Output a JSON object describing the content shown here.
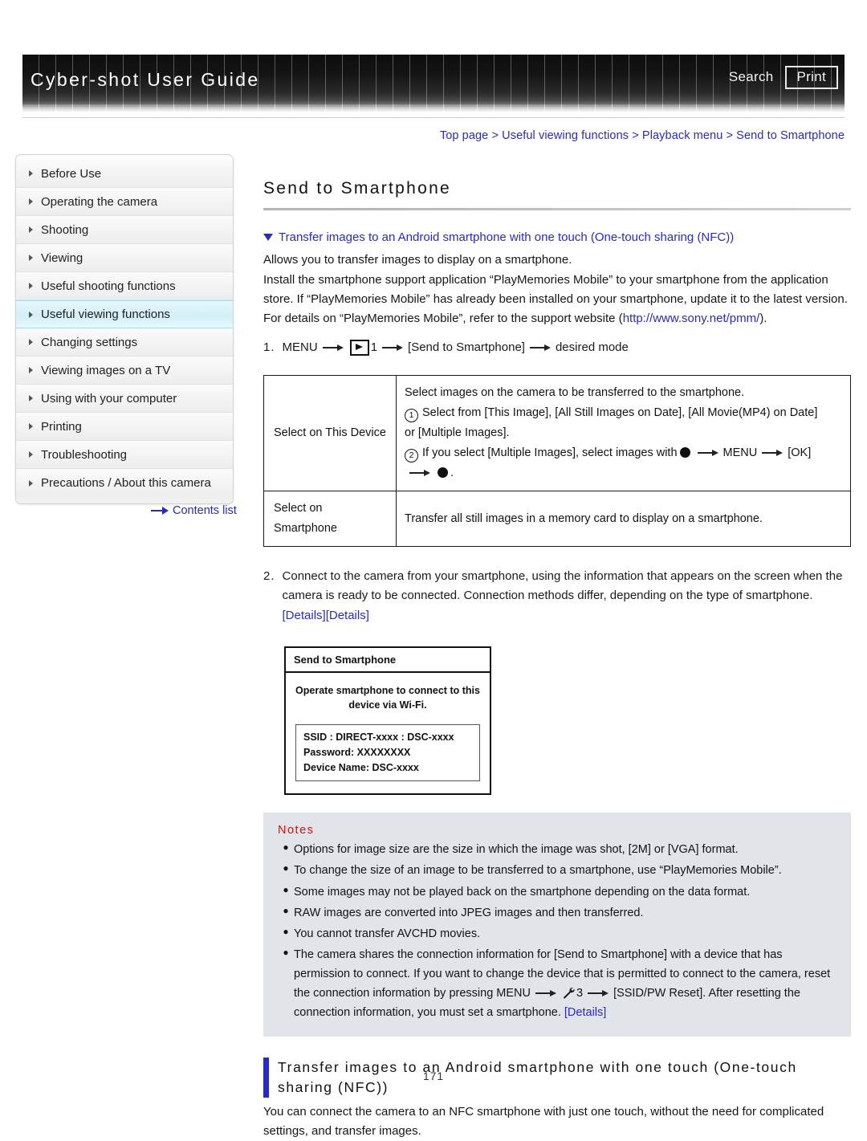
{
  "header": {
    "title": "Cyber-shot User Guide",
    "search_label": "Search",
    "print_label": "Print"
  },
  "breadcrumb": {
    "text": "Top page > Useful viewing functions > Playback menu > Send to Smartphone"
  },
  "sidebar": {
    "items": [
      {
        "label": "Before Use",
        "active": false
      },
      {
        "label": "Operating the camera",
        "active": false
      },
      {
        "label": "Shooting",
        "active": false
      },
      {
        "label": "Viewing",
        "active": false
      },
      {
        "label": "Useful shooting functions",
        "active": false
      },
      {
        "label": "Useful viewing functions",
        "active": true
      },
      {
        "label": "Changing settings",
        "active": false
      },
      {
        "label": "Viewing images on a TV",
        "active": false
      },
      {
        "label": "Using with your computer",
        "active": false
      },
      {
        "label": "Printing",
        "active": false
      },
      {
        "label": "Troubleshooting",
        "active": false
      },
      {
        "label": "Precautions / About this camera",
        "active": false
      }
    ],
    "contents_link": "Contents list"
  },
  "main": {
    "page_title": "Send to Smartphone",
    "anchor_link": "Transfer images to an Android smartphone with one touch (One-touch sharing (NFC))",
    "intro_1": "Allows you to transfer images to display on a smartphone.",
    "intro_2": "Install the smartphone support application “PlayMemories Mobile” to your smartphone from the application store. If “PlayMemories Mobile” has already been installed on your smartphone, update it to the latest version.",
    "intro_3_pre": "For details on “PlayMemories Mobile”, refer to the support website (",
    "intro_3_link": "http://www.sony.net/pmm/",
    "intro_3_post": ").",
    "step1": {
      "number": "1.",
      "menu_label": "MENU",
      "playback_icon": "playback-icon",
      "menu_page": "1",
      "bracket_item": "[Send to Smartphone]",
      "tail": "desired mode"
    },
    "table": {
      "rows": [
        {
          "label": "Select on This Device",
          "line1": "Select images on the camera to be transferred to the smartphone.",
          "marker1": "1",
          "line2a": "Select from [This Image], [All Still Images on Date], [All Movie(MP4) on Date]",
          "line2b": "or [Multiple Images].",
          "marker2": "2",
          "line3a": "If you select [Multiple Images], select images with",
          "line3b": "MENU",
          "line3c": "[OK]",
          "line3d": "."
        },
        {
          "label": "Select on Smartphone",
          "line1": "Transfer all still images in a memory card to display on a smartphone."
        }
      ]
    },
    "step2": {
      "number": "2.",
      "text": "Connect to the camera from your smartphone, using the information that appears on the screen when the camera is ready to be connected. Connection methods differ, depending on the type of smartphone.",
      "link1": "[Details]",
      "link2": "[Details]"
    },
    "camera_screen": {
      "title": "Send to Smartphone",
      "message": "Operate smartphone to connect to this device via Wi-Fi.",
      "ssid": "SSID : DIRECT-xxxx  : DSC-xxxx",
      "password": "Password: XXXXXXXX",
      "device_name": "Device Name: DSC-xxxx"
    },
    "notes": {
      "heading": "Notes",
      "items": [
        {
          "text": "Options for image size are the size in which the image was shot, [2M] or [VGA] format."
        },
        {
          "text": "To change the size of an image to be transferred to a smartphone, use “PlayMemories Mobile”."
        },
        {
          "text": "Some images may not be played back on the smartphone depending on the data format."
        },
        {
          "text": "RAW images are converted into JPEG images and then transferred."
        },
        {
          "text": "You cannot transfer AVCHD movies."
        }
      ],
      "last_item": {
        "part1": "The camera shares the connection information for [Send to Smartphone] with a device that has permission to connect. If you want to change the device that is permitted to connect to the camera, reset the connection information by pressing MENU",
        "wrench_icon": "wrench-icon",
        "menu_page": "3",
        "part2": "[SSID/PW Reset]. After resetting the connection information, you must set a smartphone.",
        "link": "[Details]"
      }
    },
    "section": {
      "heading": "Transfer images to an Android smartphone with one touch (One-touch sharing (NFC))",
      "body": "You can connect the camera to an NFC smartphone with just one touch, without the need for complicated settings, and transfer images."
    },
    "page_number": "171"
  },
  "colors": {
    "link": "#2b2bbb",
    "notes_heading": "#d41313",
    "notes_bg": "#e1e4e9",
    "sidebar_active": "#d3eff8"
  }
}
